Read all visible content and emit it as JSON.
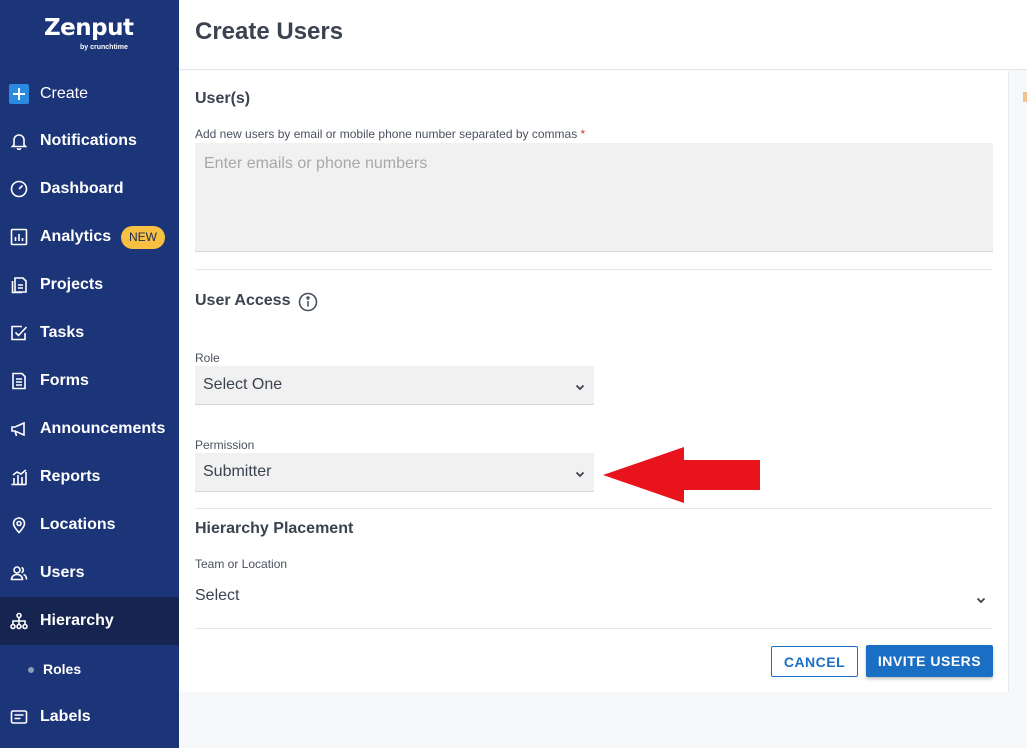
{
  "brand": {
    "name": "Zenput",
    "tagline": "by crunchtime"
  },
  "sidebar": {
    "items": [
      {
        "label": "Create",
        "icon": "plus-square-icon"
      },
      {
        "label": "Notifications",
        "icon": "bell-icon"
      },
      {
        "label": "Dashboard",
        "icon": "gauge-icon"
      },
      {
        "label": "Analytics",
        "icon": "chart-icon",
        "badge": "NEW"
      },
      {
        "label": "Projects",
        "icon": "projects-icon"
      },
      {
        "label": "Tasks",
        "icon": "checkbox-icon"
      },
      {
        "label": "Forms",
        "icon": "document-icon"
      },
      {
        "label": "Announcements",
        "icon": "megaphone-icon"
      },
      {
        "label": "Reports",
        "icon": "bar-chart-icon"
      },
      {
        "label": "Locations",
        "icon": "map-pin-icon"
      },
      {
        "label": "Users",
        "icon": "users-icon"
      },
      {
        "label": "Hierarchy",
        "icon": "hierarchy-icon"
      },
      {
        "label": "Labels",
        "icon": "label-icon"
      }
    ],
    "sub_item": {
      "label": "Roles"
    },
    "active": "Hierarchy"
  },
  "header": {
    "title": "Create Users"
  },
  "form": {
    "users_section": "User(s)",
    "users_help": "Add new users by email or mobile phone number separated by commas",
    "users_required": "*",
    "users_placeholder": "Enter emails or phone numbers",
    "access_section": "User Access",
    "role_label": "Role",
    "role_value": "Select One",
    "permission_label": "Permission",
    "permission_value": "Submitter",
    "hierarchy_section": "Hierarchy Placement",
    "team_label": "Team or Location",
    "team_value": "Select",
    "cancel": "CANCEL",
    "invite": "INVITE USERS"
  },
  "colors": {
    "sidebar": "#1c3478",
    "sidebar_active": "#15254f",
    "primary": "#1a6fc4",
    "badge": "#f7c043",
    "annotation_arrow": "#e8131b"
  }
}
